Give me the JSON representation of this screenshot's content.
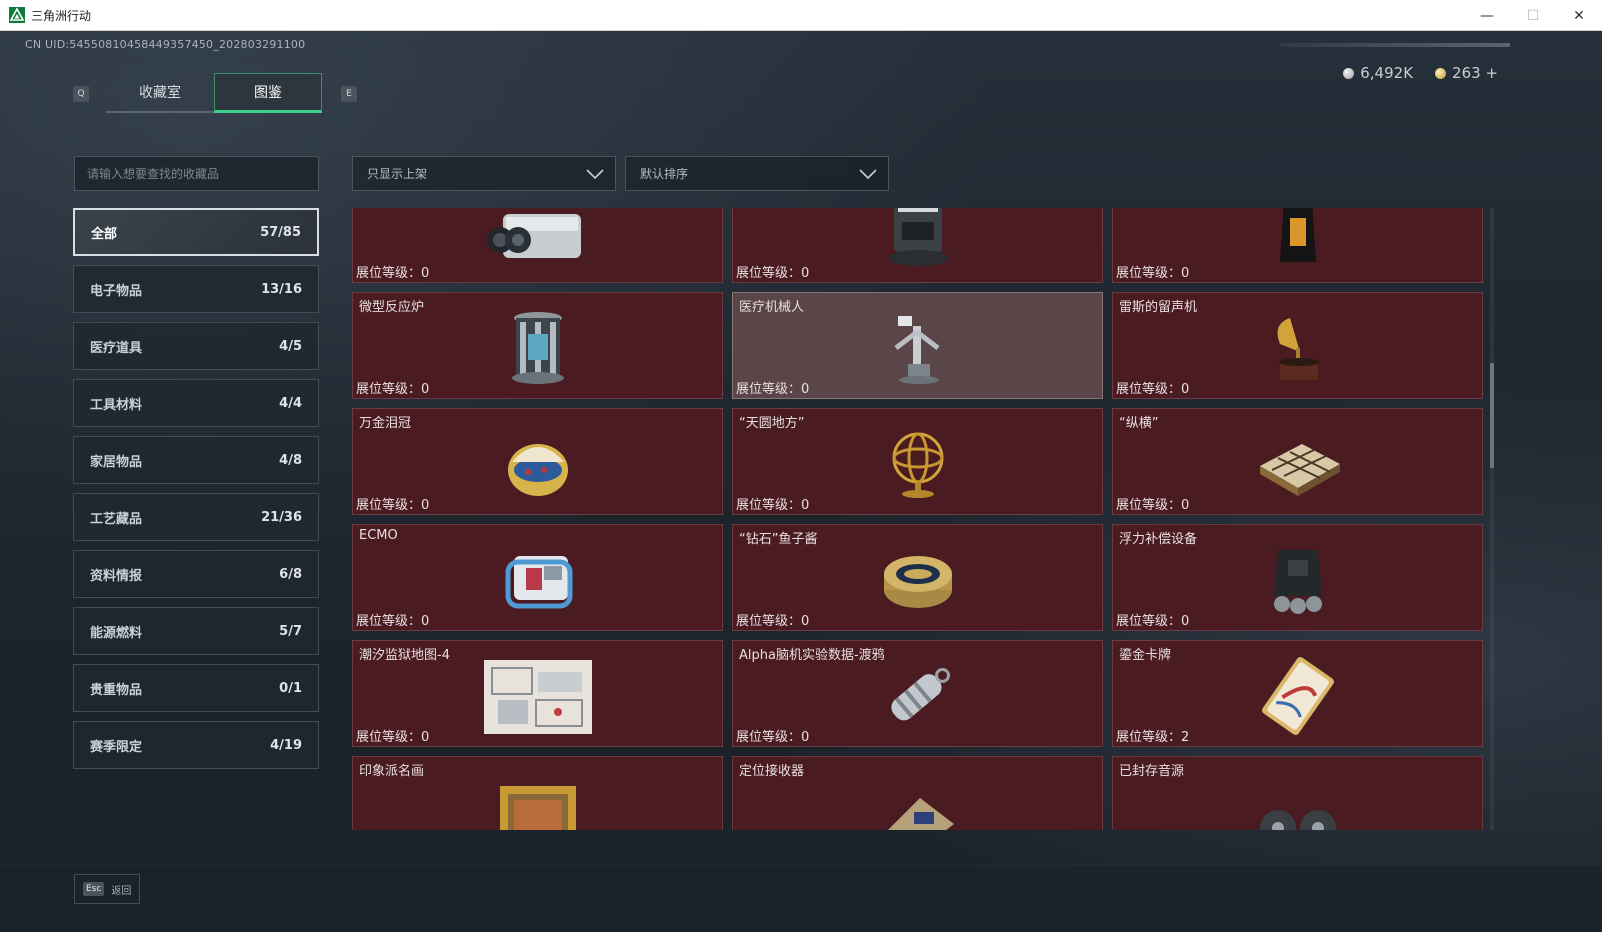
{
  "window": {
    "title": "三角洲行动",
    "min": "—",
    "max": "☐",
    "close": "✕"
  },
  "header": {
    "uid": "CN UID:54550810458449357450_202803291100",
    "tabs": [
      {
        "label": "收藏室",
        "active": false
      },
      {
        "label": "图鉴",
        "active": true
      }
    ],
    "key_prev": "Q",
    "key_next": "E",
    "currency": [
      {
        "icon": "silver-coin-icon",
        "value": "6,492K"
      },
      {
        "icon": "gold-coin-icon",
        "value": "263 +"
      }
    ]
  },
  "search": {
    "placeholder": "请输入想要查找的收藏品",
    "value": ""
  },
  "filters": {
    "display": {
      "value": "只显示上架"
    },
    "sort": {
      "value": "默认排序"
    }
  },
  "categories": [
    {
      "label": "全部",
      "count": "57/85",
      "active": true
    },
    {
      "label": "电子物品",
      "count": "13/16"
    },
    {
      "label": "医疗道具",
      "count": "4/5"
    },
    {
      "label": "工具材料",
      "count": "4/4"
    },
    {
      "label": "家居物品",
      "count": "4/8"
    },
    {
      "label": "工艺藏品",
      "count": "21/36"
    },
    {
      "label": "资料情报",
      "count": "6/8"
    },
    {
      "label": "能源燃料",
      "count": "5/7"
    },
    {
      "label": "贵重物品",
      "count": "0/1"
    },
    {
      "label": "赛季限定",
      "count": "4/19"
    }
  ],
  "items": [
    {
      "name": "",
      "level": "展位等级：0",
      "icon": "camera-array-icon"
    },
    {
      "name": "",
      "level": "展位等级：0",
      "icon": "robot-vacuum-icon"
    },
    {
      "name": "",
      "level": "展位等级：0",
      "icon": "coffee-bag-icon"
    },
    {
      "name": "微型反应炉",
      "level": "展位等级：0",
      "icon": "mini-reactor-icon"
    },
    {
      "name": "医疗机械人",
      "level": "展位等级：0",
      "icon": "medical-robot-icon",
      "highlight": true
    },
    {
      "name": "雷斯的留声机",
      "level": "展位等级：0",
      "icon": "gramophone-icon"
    },
    {
      "name": "万金泪冠",
      "level": "展位等级：0",
      "icon": "jeweled-egg-icon"
    },
    {
      "name": "“天圆地方”",
      "level": "展位等级：0",
      "icon": "armillary-sphere-icon"
    },
    {
      "name": "“纵横”",
      "level": "展位等级：0",
      "icon": "chessboard-icon"
    },
    {
      "name": "ECMO",
      "level": "展位等级：0",
      "icon": "ecmo-machine-icon"
    },
    {
      "name": "“钻石”鱼子酱",
      "level": "展位等级：0",
      "icon": "caviar-tin-icon"
    },
    {
      "name": "浮力补偿设备",
      "level": "展位等级：0",
      "icon": "buoyancy-vest-icon"
    },
    {
      "name": "潮汐监狱地图-4",
      "level": "展位等级：0",
      "icon": "prison-map-icon"
    },
    {
      "name": "Alpha脑机实验数据-渡鸦",
      "level": "展位等级：0",
      "icon": "data-canister-icon"
    },
    {
      "name": "鎏金卡牌",
      "level": "展位等级：2",
      "icon": "gilded-card-icon"
    },
    {
      "name": "印象派名画",
      "level": "",
      "icon": "framed-painting-icon"
    },
    {
      "name": "定位接收器",
      "level": "",
      "icon": "locator-receiver-icon"
    },
    {
      "name": "已封存音源",
      "level": "",
      "icon": "reel-tape-icon"
    }
  ],
  "footer": {
    "esc_key": "Esc",
    "back_label": "返回"
  },
  "colors": {
    "accent": "#3fd08e",
    "card_bg": "#4a1c22",
    "card_highlight": "#5a4649",
    "bg": "#1b232b"
  }
}
